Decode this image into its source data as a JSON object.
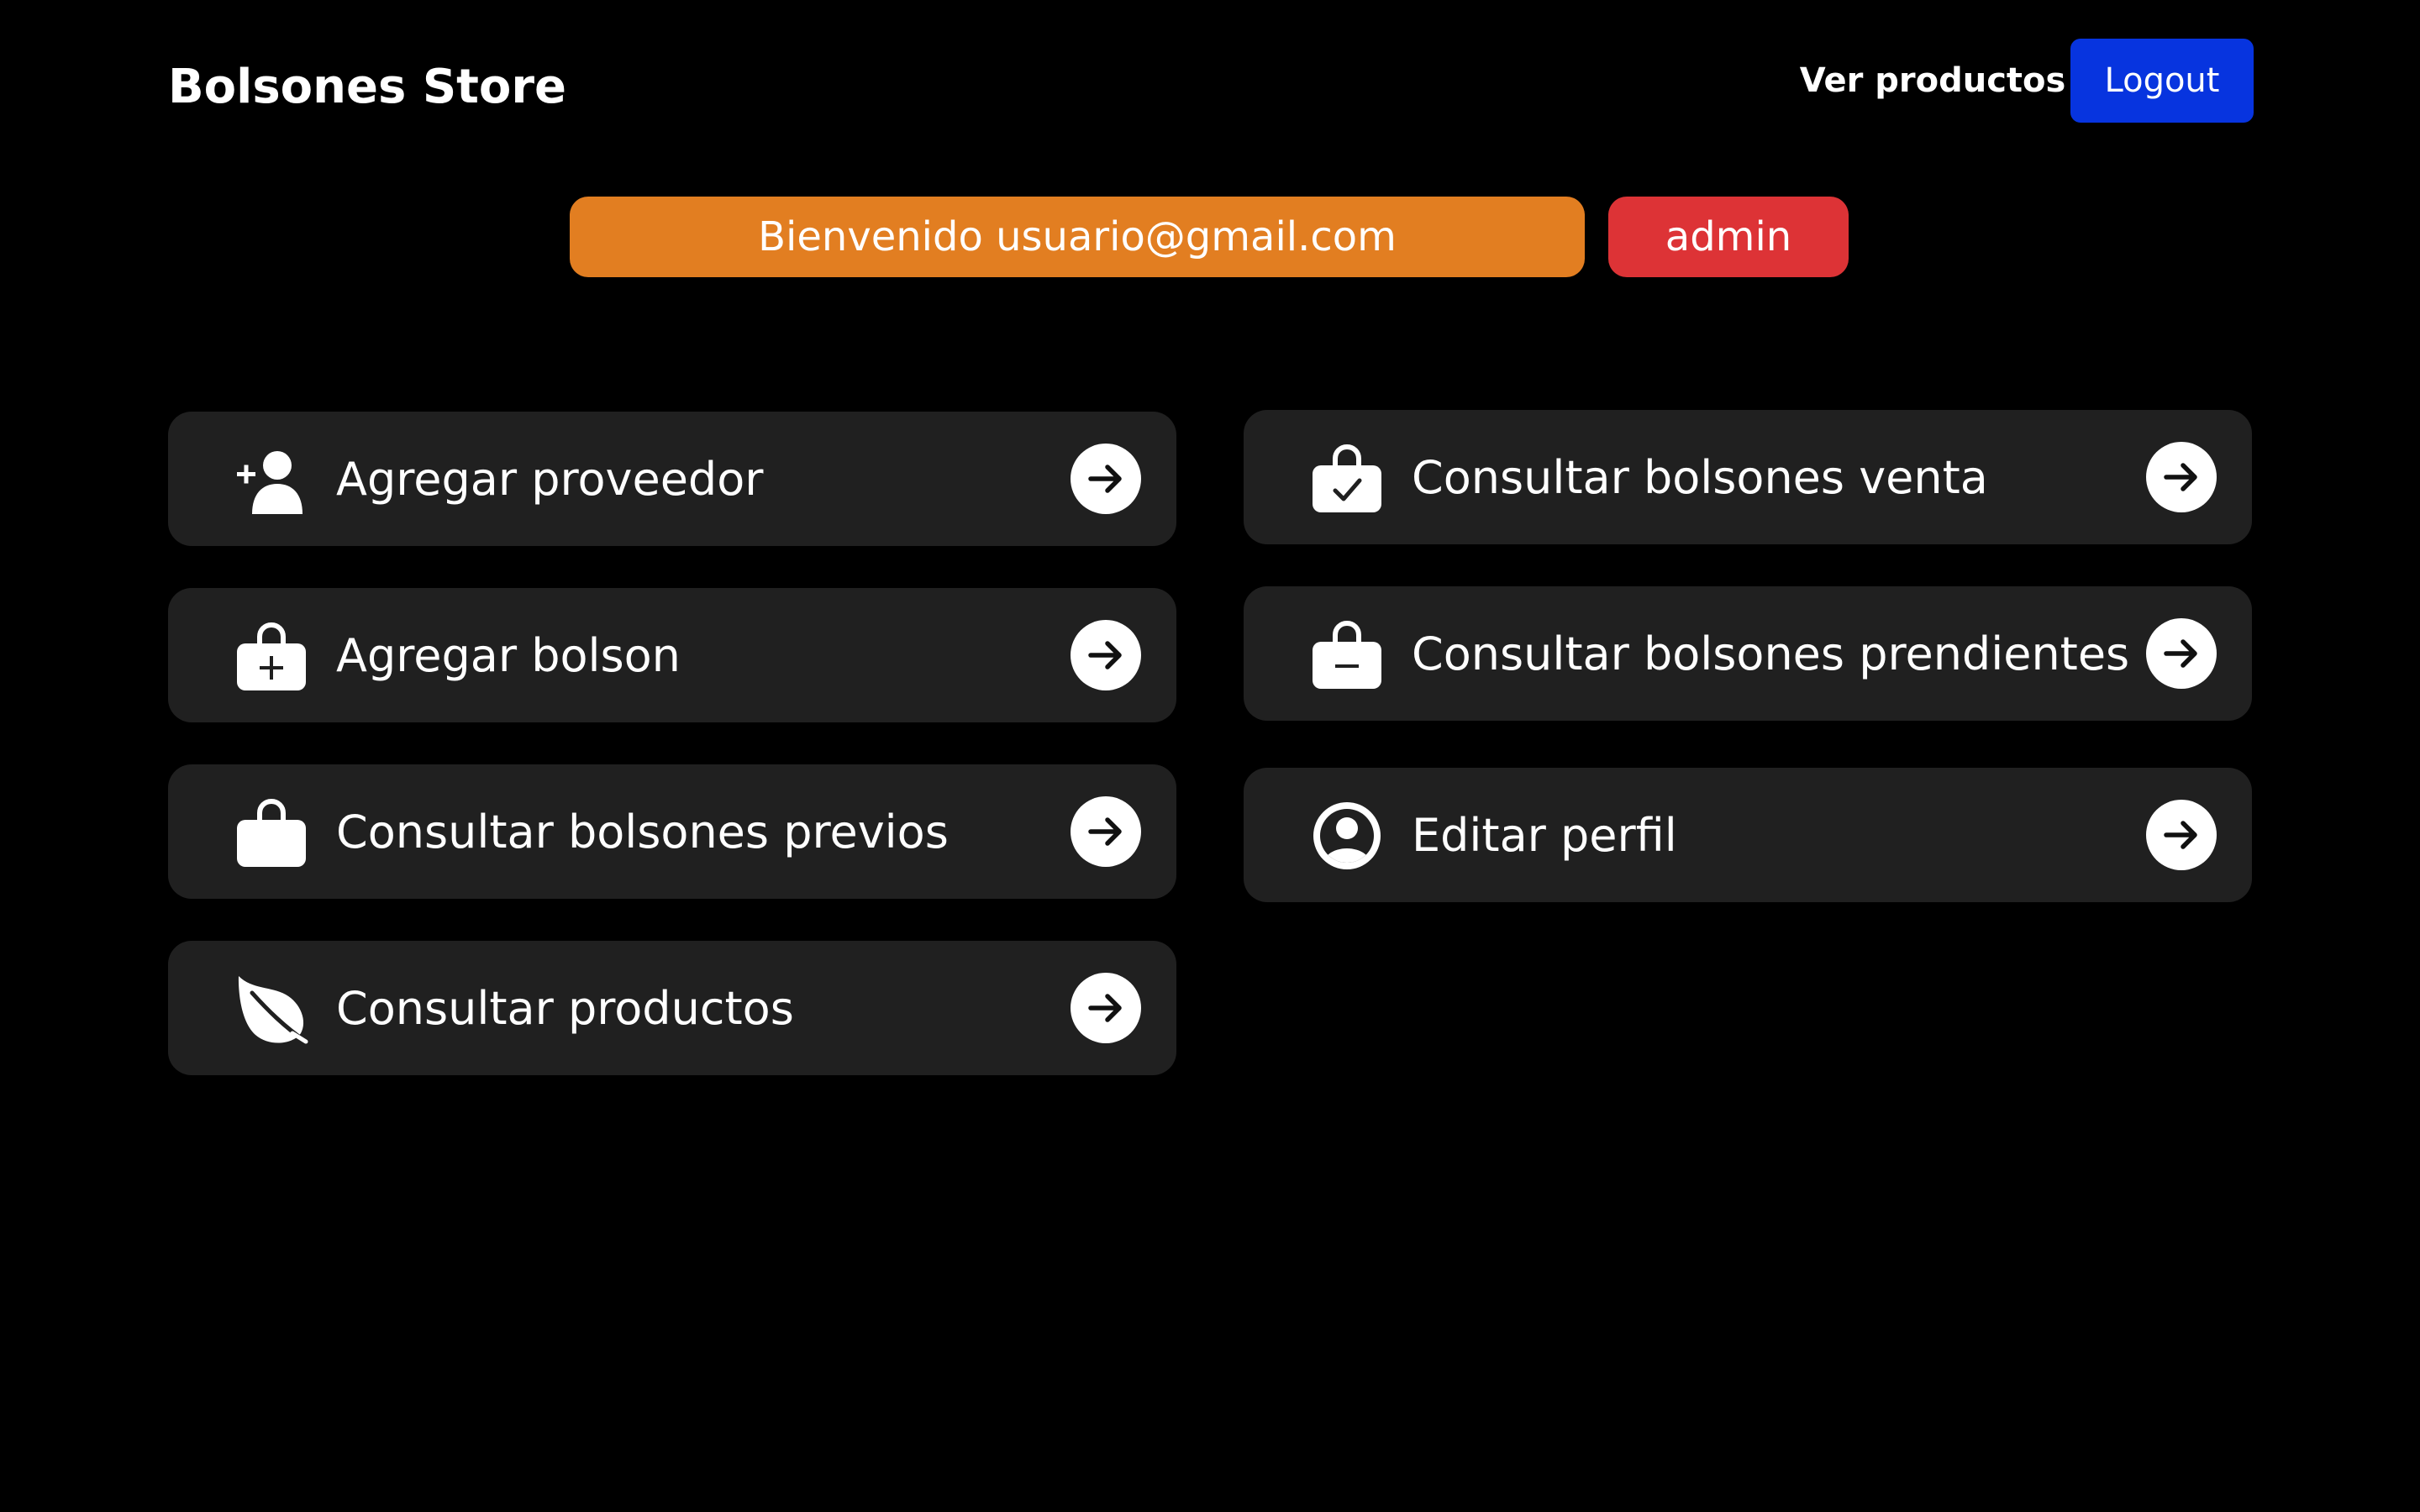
{
  "header": {
    "brand": "Bolsones Store",
    "nav_link": "Ver productos",
    "logout_label": "Logout"
  },
  "welcome": {
    "message": "Bienvenido usuario@gmail.com",
    "role": "admin"
  },
  "colors": {
    "background": "#000000",
    "card": "#202020",
    "logout": "#0734df",
    "welcome_badge": "#e27e21",
    "role_badge": "#dd3336"
  },
  "menu": {
    "left": [
      {
        "label": "Agregar proveedor",
        "icon": "add-user-icon"
      },
      {
        "label": "Agregar bolson",
        "icon": "bag-plus-icon"
      },
      {
        "label": "Consultar bolsones previos",
        "icon": "bag-icon"
      },
      {
        "label": "Consultar productos",
        "icon": "leaf-icon"
      }
    ],
    "right": [
      {
        "label": "Consultar bolsones venta",
        "icon": "bag-check-icon"
      },
      {
        "label": "Consultar bolsones prendientes",
        "icon": "bag-minus-icon"
      },
      {
        "label": "Editar perfil",
        "icon": "user-circle-icon"
      }
    ],
    "arrow_icon": "arrow-right-circle-icon"
  }
}
